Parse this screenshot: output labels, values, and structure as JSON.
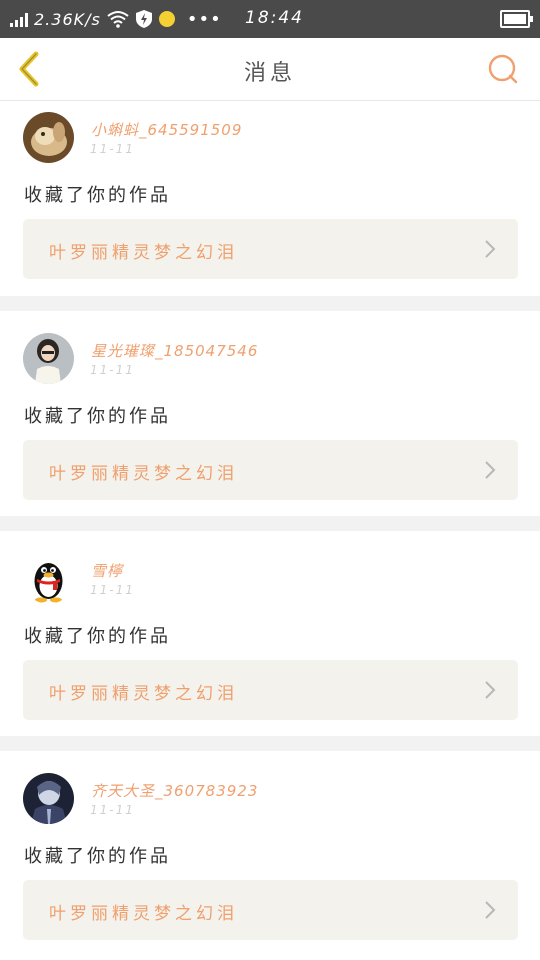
{
  "status_bar": {
    "speed": "2.36K/s",
    "dots": "•••",
    "time": "18:44"
  },
  "header": {
    "title": "消息",
    "back_icon": "chevron-left-icon",
    "search_icon": "search-icon"
  },
  "colors": {
    "accent": "#f0a06e",
    "back_arrow": "#e6c325",
    "card_bg": "#f3f2ec"
  },
  "messages": [
    {
      "user": "小蝌蚪_645591509",
      "date": "11-11",
      "action": "收藏了你的作品",
      "work": "叶罗丽精灵梦之幻泪"
    },
    {
      "user": "星光璀璨_185047546",
      "date": "11-11",
      "action": "收藏了你的作品",
      "work": "叶罗丽精灵梦之幻泪"
    },
    {
      "user": "雪檸",
      "date": "11-11",
      "action": "收藏了你的作品",
      "work": "叶罗丽精灵梦之幻泪"
    },
    {
      "user": "齐天大圣_360783923",
      "date": "11-11",
      "action": "收藏了你的作品",
      "work": "叶罗丽精灵梦之幻泪"
    }
  ]
}
